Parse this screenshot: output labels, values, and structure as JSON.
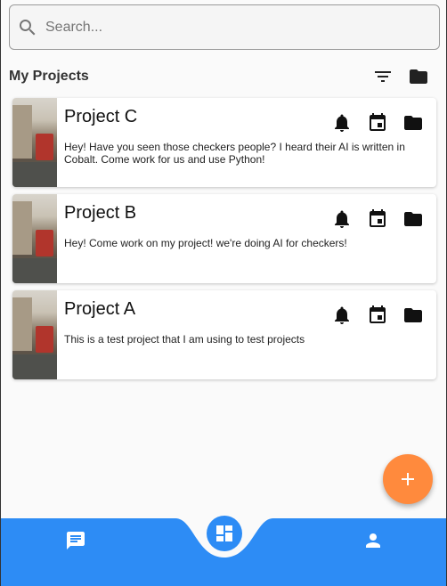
{
  "search": {
    "placeholder": "Search..."
  },
  "header": {
    "title": "My Projects"
  },
  "projects": [
    {
      "name": "Project C",
      "description": "Hey! Have you seen those checkers people? I heard their AI is written in Cobalt. Come work for us and use Python!"
    },
    {
      "name": "Project B",
      "description": "Hey! Come work on my project! we're doing AI for checkers!"
    },
    {
      "name": "Project A",
      "description": "This is a test project that I am using to test projects"
    }
  ],
  "icons": {
    "search": "search-icon",
    "filter": "filter-icon",
    "folder": "folder-icon",
    "bell": "bell-icon",
    "calendar": "calendar-icon",
    "add": "plus-icon",
    "chat": "chat-icon",
    "dashboard": "dashboard-icon",
    "profile": "person-icon"
  },
  "colors": {
    "accent": "#2d8cf5",
    "fab": "#ff8a3d",
    "background": "#fafafa"
  }
}
